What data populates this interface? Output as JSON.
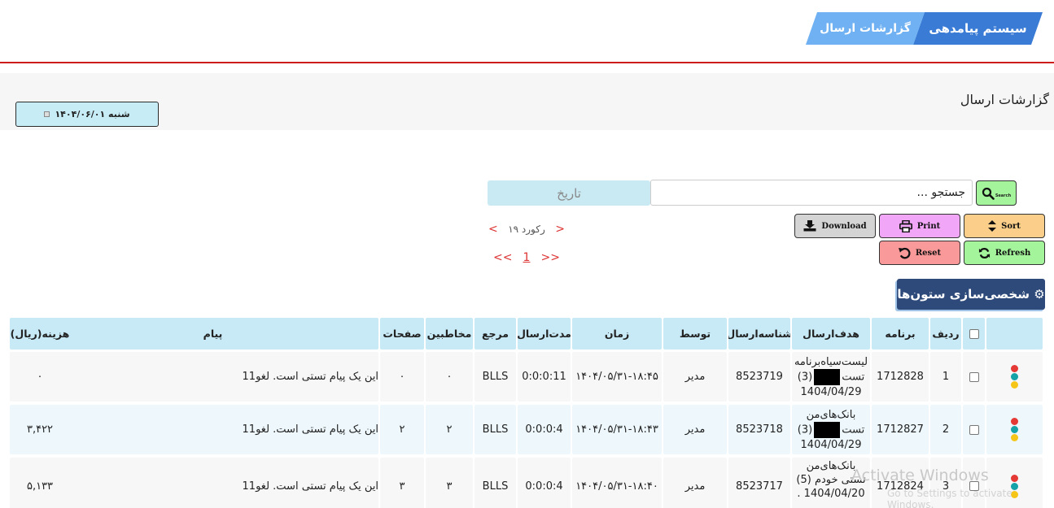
{
  "header": {
    "system_tab": "سیستم پیامدهی",
    "page_tab": "گزارشات ارسال"
  },
  "page": {
    "title": "گزارشات ارسال",
    "date_label": "شنبه ۱۴۰۴/۰۶/۰۱"
  },
  "search": {
    "button_label": "Search",
    "input_value": "جستجو ...",
    "date_placeholder": "تاریخ"
  },
  "actions": {
    "sort": "Sort",
    "print": "Print",
    "download": "Download",
    "refresh": "Refresh",
    "reset": "Reset"
  },
  "pager": {
    "prev": "<",
    "next": ">",
    "records": "۱۹ رکورد",
    "first": "<<",
    "last": ">>",
    "current_page": "1"
  },
  "columns_button": "⚙ شخصی‌سازی ستون‌ها",
  "table": {
    "headers": {
      "row": "ردیف",
      "program": "برنامه",
      "target": "هدف‌ارسال",
      "send_id": "شناسه‌ارسال",
      "by": "توسط",
      "time": "زمان",
      "duration": "مدت‌ارسال",
      "ref": "مرجع",
      "recipients": "مخاطبین",
      "pages": "صفحات",
      "message": "پیام",
      "cost": "هزینه(ریال)"
    },
    "rows": [
      {
        "row": "1",
        "program": "1712828",
        "target_l1": "لیست‌سیاه‌برنامه",
        "target_l2a": "تست",
        "target_l2b": "(3)",
        "target_l3": "1404/04/29",
        "send_id": "8523719",
        "by": "مدیر",
        "time": "۱۴۰۴/۰۵/۳۱-۱۸:۴۵",
        "duration": "0:0:0:11",
        "ref": "BLLS",
        "recipients": "۰",
        "pages": "۰",
        "message": "این یک پیام تستی است. لغو11",
        "cost": "۰"
      },
      {
        "row": "2",
        "program": "1712827",
        "target_l1": "بانک‌های‌من",
        "target_l2a": "تست",
        "target_l2b": "(3)",
        "target_l3": "1404/04/29",
        "send_id": "8523718",
        "by": "مدیر",
        "time": "۱۴۰۴/۰۵/۳۱-۱۸:۴۳",
        "duration": "0:0:0:4",
        "ref": "BLLS",
        "recipients": "۲",
        "pages": "۲",
        "message": "این یک پیام تستی است. لغو11",
        "cost": "۳,۴۲۲"
      },
      {
        "row": "3",
        "program": "1712824",
        "target_l1": "بانک‌های‌من",
        "target_l2a": "تستی خودم (5)",
        "target_l3": "1404/04/20 .",
        "send_id": "8523717",
        "by": "مدیر",
        "time": "۱۴۰۴/۰۵/۳۱-۱۸:۴۰",
        "duration": "0:0:0:4",
        "ref": "BLLS",
        "recipients": "۳",
        "pages": "۳",
        "message": "این یک پیام تستی است. لغو11",
        "cost": "۵,۱۳۳"
      }
    ]
  },
  "watermark": {
    "line1": "Activate Windows",
    "line2": "Go to Settings to activate Windows."
  },
  "colors": {
    "accent": "#3a7bd5",
    "header_line": "#cc1c1c",
    "table_header": "#c7eaf6"
  }
}
